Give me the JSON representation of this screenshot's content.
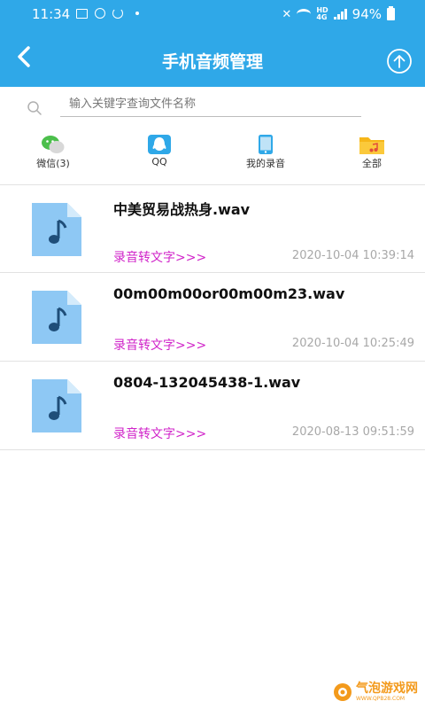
{
  "status_bar": {
    "time": "11:34",
    "network_label": "HD",
    "network_gen": "4G",
    "battery": "94%"
  },
  "header": {
    "title": "手机音频管理",
    "back_icon": "chevron-left-icon",
    "upload_icon": "upload-circle-icon",
    "background_color": "#2fa8e8"
  },
  "search": {
    "placeholder": "输入关键字查询文件名称",
    "value": ""
  },
  "categories": [
    {
      "label": "微信(3)",
      "icon": "wechat-icon",
      "color": "#4cbf4c"
    },
    {
      "label": "QQ",
      "icon": "qq-icon",
      "color": "#2fa8e8"
    },
    {
      "label": "我的录音",
      "icon": "phone-icon",
      "color": "#2fa8e8"
    },
    {
      "label": "全部",
      "icon": "folder-music-icon",
      "color": "#f6b619"
    }
  ],
  "files": [
    {
      "name": "中美贸易战热身.wav",
      "action": "录音转文字>>>",
      "time": "2020-10-04 10:39:14"
    },
    {
      "name": "00m00m00or00m00m23.wav",
      "action": "录音转文字>>>",
      "time": "2020-10-04 10:25:49"
    },
    {
      "name": "0804-132045438-1.wav",
      "action": "录音转文字>>>",
      "time": "2020-08-13 09:51:59"
    }
  ],
  "colors": {
    "accent": "#2fa8e8",
    "link": "#d024c9",
    "timestamp": "#a8a8a8",
    "file_icon": "#8ec8f4"
  },
  "watermark": {
    "main": "气泡游戏网",
    "sub": "WWW.QPB28.COM"
  }
}
